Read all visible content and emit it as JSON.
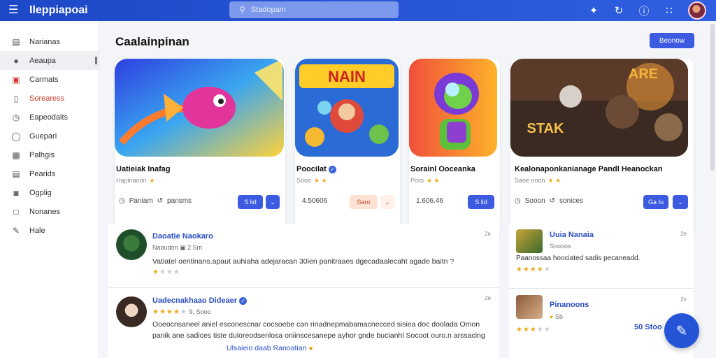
{
  "header": {
    "app_title": "Ileppiapoai",
    "search_placeholder": "Stadopam",
    "icons": [
      "logo-icon",
      "search-icon",
      "bolt-icon",
      "refresh-icon",
      "info-icon",
      "grid-icon",
      "avatar"
    ]
  },
  "sidebar": {
    "items": [
      {
        "label": "Narianas",
        "icon": "document-icon"
      },
      {
        "label": "Aeaupa",
        "icon": "gamepad-icon"
      },
      {
        "label": "Carmats",
        "icon": "calendar-icon"
      },
      {
        "label": "Sorearess",
        "icon": "bookmark-icon"
      },
      {
        "label": "Eapeodaits",
        "icon": "clock-icon"
      },
      {
        "label": "Guepari",
        "icon": "shield-icon"
      },
      {
        "label": "Palhgis",
        "icon": "folder-icon"
      },
      {
        "label": "Pearids",
        "icon": "list-icon"
      },
      {
        "label": "Ogplig",
        "icon": "upload-icon"
      },
      {
        "label": "Nonanes",
        "icon": "square-icon"
      },
      {
        "label": "Hale",
        "icon": "pen-icon"
      }
    ]
  },
  "main": {
    "title": "Caalainpinan",
    "primary_button": "Beonow",
    "cards": [
      {
        "name": "Uatieiak Inafag",
        "verified": false,
        "sub": "Hapinaoon",
        "stars": "★",
        "foot_left": "Paniam",
        "foot_right": "pansms",
        "button": "S lid",
        "chevron": "⌄"
      },
      {
        "name": "Poocilat",
        "verified": true,
        "sub": "Sooo",
        "stars": "★ ★",
        "foot_left": "4.50606",
        "button": "Saro",
        "chevron": "⌄"
      },
      {
        "name": "Sorainl Ooceanka",
        "verified": false,
        "sub": "Poro",
        "stars": "★ ★",
        "foot_left": "1.606.46",
        "button": "S lid",
        "chevron": ""
      },
      {
        "name": "Kealonaponkanianage Pandl Heanockan",
        "verified": false,
        "sub": "Saoe noon",
        "stars": "★ ★",
        "foot_left": "Sooon",
        "foot_right": "sonices",
        "button": "Ga Iu",
        "chevron": "⌄"
      }
    ],
    "reviews": [
      {
        "name": "Daoatie Naokaro",
        "meta": "Naoudon",
        "count": "2 Sm",
        "time": "2ɐ",
        "text": "Vatiatel oentinans.apaut auhiaha adejaracan 30ien panitraaes dgecadaalecaht agade baitn ?",
        "stars_on": 1,
        "stars_off": 3
      },
      {
        "name": "Uadecnakhaao Dideaer",
        "meta": "9, Sooo",
        "time": "2ɐ",
        "text": "Ooeocnsaneel aniel esconescnar cocsoebe can rinadnepmabamacnecced sisiea doc doolada Omon panik ane sadices tiste duloreodsenlosa oniinscesanepe ayhor gnde bucianhl Socoot ouro.n arssacing",
        "link": "Ulsaieio daab Ranoatian",
        "stars_on": 4,
        "stars_off": 1
      }
    ],
    "side_items": [
      {
        "name": "Uuia Nanaia",
        "sub": "Soooos",
        "desc": "Paanossaa hoociated sadis pecaneadd.",
        "time": "2ɐ",
        "stars_on": 4,
        "stars_off": 1
      },
      {
        "name": "Pinanoons",
        "sub": "Sb",
        "time": "2ɐ",
        "stars_on": 3,
        "stars_off": 2
      }
    ],
    "fab_label": "50 Stoo"
  },
  "colors": {
    "accent": "#2f5fe0",
    "link": "#2b4fc4",
    "star": "#f0a818",
    "danger": "#c63a2b"
  }
}
